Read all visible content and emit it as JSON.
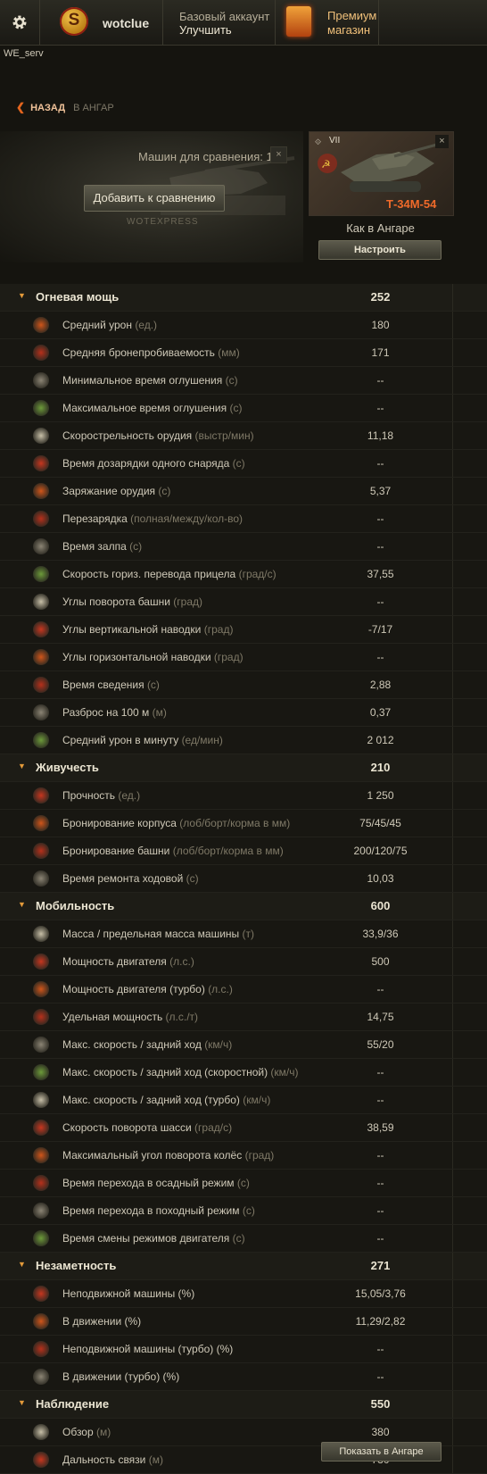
{
  "header": {
    "player_name": "wotclue",
    "rank_letter": "S",
    "account_type": "Базовый аккаунт",
    "upgrade_label": "Улучшить",
    "premium_label": "Премиум магазин",
    "server": "WE_serv"
  },
  "nav": {
    "back_label": "НАЗАД",
    "back_target": "В АНГАР"
  },
  "compare": {
    "count_label": "Машин для сравнения: 1",
    "clear_label": "×",
    "add_button": "Добавить к сравнению",
    "watermark": "WOTEXPRESS"
  },
  "vehicle": {
    "tier": "VII",
    "name": "Т-34М-54",
    "config_label": "Как в Ангаре",
    "setup_button": "Настроить",
    "close_label": "×"
  },
  "footer": {
    "show_in_hangar": "Показать в Ангаре"
  },
  "colors": {
    "accent": "#f06a2a",
    "category_arrow": "#e39a3a",
    "unit_text": "#7f7967"
  },
  "stats": [
    {
      "type": "group",
      "label": "Огневая мощь",
      "value": "252"
    },
    {
      "type": "stat",
      "icon": "damage-icon",
      "label": "Средний урон",
      "unit": "(ед.)",
      "value": "180"
    },
    {
      "type": "stat",
      "icon": "penetration-icon",
      "label": "Средняя бронепробиваемость",
      "unit": "(мм)",
      "value": "171"
    },
    {
      "type": "stat",
      "icon": "stun-min-icon",
      "label": "Минимальное время оглушения",
      "unit": "(с)",
      "value": "--"
    },
    {
      "type": "stat",
      "icon": "stun-max-icon",
      "label": "Максимальное время оглушения",
      "unit": "(с)",
      "value": "--"
    },
    {
      "type": "stat",
      "icon": "rate-of-fire-icon",
      "label": "Скорострельность орудия",
      "unit": "(выстр/мин)",
      "value": "11,18"
    },
    {
      "type": "stat",
      "icon": "shell-reload-icon",
      "label": "Время дозарядки одного снаряда",
      "unit": "(с)",
      "value": "--"
    },
    {
      "type": "stat",
      "icon": "reload-icon",
      "label": "Заряжание орудия",
      "unit": "(с)",
      "value": "5,37"
    },
    {
      "type": "stat",
      "icon": "magazine-reload-icon",
      "label": "Перезарядка",
      "unit": "(полная/между/кол-во)",
      "value": "--"
    },
    {
      "type": "stat",
      "icon": "salvo-icon",
      "label": "Время залпа",
      "unit": "(с)",
      "value": "--"
    },
    {
      "type": "stat",
      "icon": "traverse-speed-icon",
      "label": "Скорость гориз. перевода прицела",
      "unit": "(град/с)",
      "value": "37,55"
    },
    {
      "type": "stat",
      "icon": "turret-rotation-icon",
      "label": "Углы поворота башни",
      "unit": "(град)",
      "value": "--"
    },
    {
      "type": "stat",
      "icon": "elevation-icon",
      "label": "Углы вертикальной наводки",
      "unit": "(град)",
      "value": "-7/17"
    },
    {
      "type": "stat",
      "icon": "horizontal-aim-icon",
      "label": "Углы горизонтальной наводки",
      "unit": "(град)",
      "value": "--"
    },
    {
      "type": "stat",
      "icon": "aim-time-icon",
      "label": "Время сведения",
      "unit": "(с)",
      "value": "2,88"
    },
    {
      "type": "stat",
      "icon": "dispersion-icon",
      "label": "Разброс на 100 м",
      "unit": "(м)",
      "value": "0,37"
    },
    {
      "type": "stat",
      "icon": "dpm-icon",
      "label": "Средний урон в минуту",
      "unit": "(ед/мин)",
      "value": "2 012"
    },
    {
      "type": "group",
      "label": "Живучесть",
      "value": "210"
    },
    {
      "type": "stat",
      "icon": "hit-points-icon",
      "label": "Прочность",
      "unit": "(ед.)",
      "value": "1 250"
    },
    {
      "type": "stat",
      "icon": "hull-armor-icon",
      "label": "Бронирование корпуса",
      "unit": "(лоб/борт/корма в мм)",
      "value": "75/45/45"
    },
    {
      "type": "stat",
      "icon": "turret-armor-icon",
      "label": "Бронирование башни",
      "unit": "(лоб/борт/корма в мм)",
      "value": "200/120/75"
    },
    {
      "type": "stat",
      "icon": "repair-icon",
      "label": "Время ремонта ходовой",
      "unit": "(с)",
      "value": "10,03"
    },
    {
      "type": "group",
      "label": "Мобильность",
      "value": "600"
    },
    {
      "type": "stat",
      "icon": "weight-icon",
      "label": "Масса / предельная масса машины",
      "unit": "(т)",
      "value": "33,9/36"
    },
    {
      "type": "stat",
      "icon": "engine-power-icon",
      "label": "Мощность двигателя",
      "unit": "(л.с.)",
      "value": "500"
    },
    {
      "type": "stat",
      "icon": "engine-turbo-icon",
      "label": "Мощность двигателя (турбо)",
      "unit": "(л.с.)",
      "value": "--"
    },
    {
      "type": "stat",
      "icon": "specific-power-icon",
      "label": "Удельная мощность",
      "unit": "(л.с./т)",
      "value": "14,75"
    },
    {
      "type": "stat",
      "icon": "speed-icon",
      "label": "Макс. скорость / задний ход",
      "unit": "(км/ч)",
      "value": "55/20"
    },
    {
      "type": "stat",
      "icon": "speed-fast-icon",
      "label": "Макс. скорость / задний ход (скоростной)",
      "unit": "(км/ч)",
      "value": "--"
    },
    {
      "type": "stat",
      "icon": "speed-turbo-icon",
      "label": "Макс. скорость / задний ход (турбо)",
      "unit": "(км/ч)",
      "value": "--"
    },
    {
      "type": "stat",
      "icon": "hull-traverse-icon",
      "label": "Скорость поворота шасси",
      "unit": "(град/с)",
      "value": "38,59"
    },
    {
      "type": "stat",
      "icon": "wheel-angle-icon",
      "label": "Максимальный угол поворота колёс",
      "unit": "(град)",
      "value": "--"
    },
    {
      "type": "stat",
      "icon": "siege-mode-icon",
      "label": "Время перехода в осадный режим ",
      "unit": "(с)",
      "value": "--"
    },
    {
      "type": "stat",
      "icon": "travel-mode-icon",
      "label": "Время перехода в походный режим ",
      "unit": "(с)",
      "value": "--"
    },
    {
      "type": "stat",
      "icon": "engine-mode-icon",
      "label": "Время смены режимов двигателя",
      "unit": "(с)",
      "value": "--"
    },
    {
      "type": "group",
      "label": "Незаметность",
      "value": "271"
    },
    {
      "type": "stat",
      "icon": "camo-still-icon",
      "label": "Неподвижной машины (%)",
      "unit": "",
      "value": "15,05/3,76"
    },
    {
      "type": "stat",
      "icon": "camo-moving-icon",
      "label": "В движении (%)",
      "unit": "",
      "value": "11,29/2,82"
    },
    {
      "type": "stat",
      "icon": "camo-still-turbo-icon",
      "label": "Неподвижной машины (турбо) (%)",
      "unit": "",
      "value": "--"
    },
    {
      "type": "stat",
      "icon": "camo-moving-turbo-icon",
      "label": "В движении (турбо) (%)",
      "unit": "",
      "value": "--"
    },
    {
      "type": "group",
      "label": "Наблюдение",
      "value": "550"
    },
    {
      "type": "stat",
      "icon": "view-range-icon",
      "label": "Обзор",
      "unit": "(м)",
      "value": "380"
    },
    {
      "type": "stat",
      "icon": "radio-range-icon",
      "label": "Дальность связи",
      "unit": "(м)",
      "value": "730"
    }
  ]
}
